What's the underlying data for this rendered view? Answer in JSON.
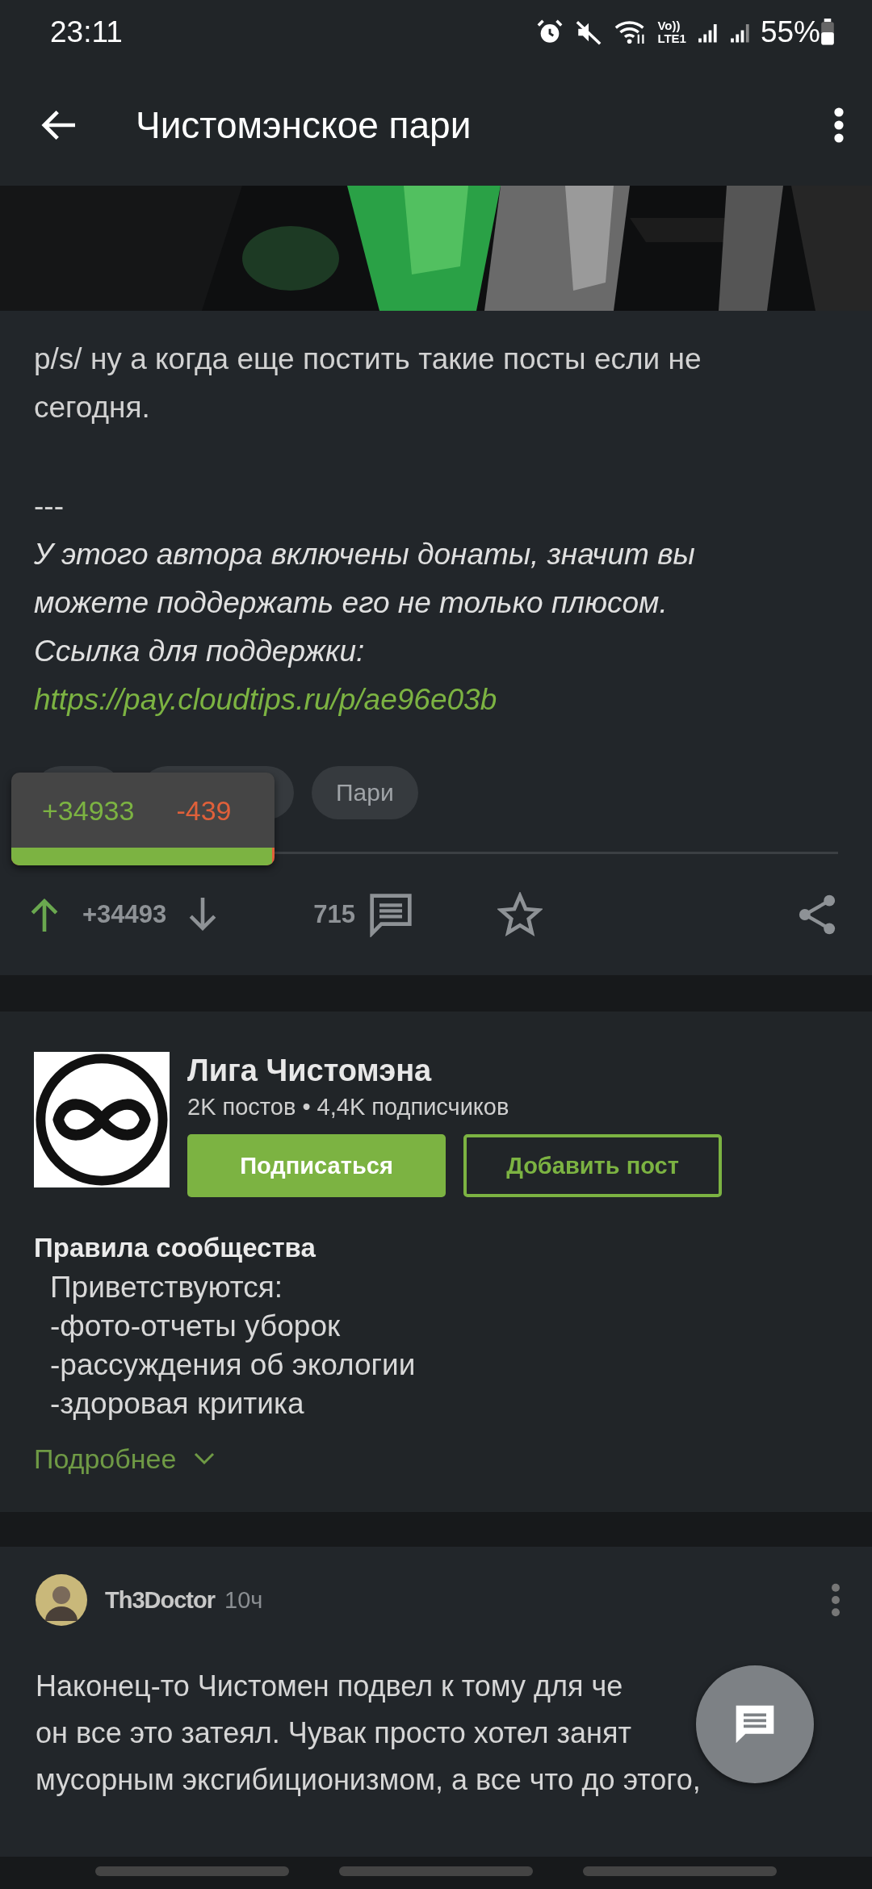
{
  "status_bar": {
    "time": "23:11",
    "volte": "Vo))",
    "network": "LTE1",
    "battery": "55%"
  },
  "app_bar": {
    "title": "Чистомэнское пари"
  },
  "post": {
    "text": "p/s/ ну а когда еще постить такие посты если не сегодня.",
    "separator": "---",
    "donation_note": "У этого автора включены донаты, значит вы можете поддержать его не только плюсом.",
    "support_label": "Ссылка для поддержки:",
    "support_link": "https://pay.cloudtips.ru/p/ae96e03b",
    "tags": [
      {
        "label": "Пари"
      }
    ],
    "rating_popup": {
      "pluses": "+34933",
      "minuses": "-439",
      "level": 0.99
    },
    "upvoted": true,
    "rating": "+34493",
    "comments": "715"
  },
  "community": {
    "name": "Лига Чистомэна",
    "stats": "2K постов • 4,4K подписчиков",
    "subscribe_button": "Подписаться",
    "add_post_button": "Добавить пост",
    "rules_title": "Правила сообщества",
    "rules": [
      "Приветствуются:",
      "-фото-отчеты уборок",
      "-рассуждения об экологии",
      "-здоровая критика"
    ],
    "more_link": "Подробнее"
  },
  "comment": {
    "author": "Th3Doctor",
    "time": "10ч",
    "lines": [
      "Наконец-то Чистомен подвел к тому для че",
      "он все это затеял. Чувак просто хотел занят",
      "мусорным эксгибиционизмом, а все что до этого,"
    ]
  }
}
